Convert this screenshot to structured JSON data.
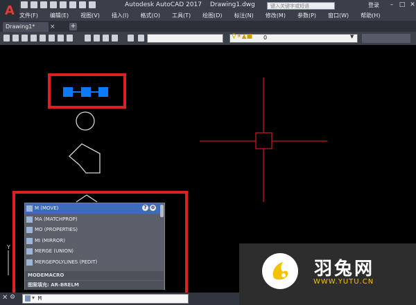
{
  "window": {
    "app_logo": "A",
    "title_app": "Autodesk AutoCAD 2017",
    "title_file": "Drawing1.dwg",
    "search_placeholder": "键入关键字或短语",
    "login_label": "登录",
    "controls": [
      "–",
      "□",
      "✕"
    ]
  },
  "menu": {
    "items": [
      "文件(F)",
      "编辑(E)",
      "视图(V)",
      "插入(I)",
      "格式(O)",
      "工具(T)",
      "绘图(D)",
      "标注(N)",
      "修改(M)",
      "参数(P)",
      "窗口(W)",
      "帮助(H)"
    ]
  },
  "tabs": {
    "drawing": "Drawing1*",
    "close": "×",
    "add": "+"
  },
  "toolbar": {
    "layer_value": "0",
    "layer_icons": "♀☀▲■"
  },
  "autocomplete": {
    "items": [
      {
        "label": "M (MOVE)"
      },
      {
        "label": "MA (MATCHPROP)"
      },
      {
        "label": "MO (PROPERTIES)"
      },
      {
        "label": "MI (MIRROR)"
      },
      {
        "label": "MERGE (UNION)"
      },
      {
        "label": "MERGEPOLYLINES (PEDIT)"
      }
    ],
    "sections": [
      "MODEMACRO",
      "图案填充: AR-BRELM"
    ],
    "help_label": "?",
    "internet_label": "⊕"
  },
  "command_line": {
    "input_value": "M",
    "close_glyph": "✕",
    "wrench_glyph": "⚙",
    "prompt_arrow": "▾"
  },
  "axis": {
    "y_label": "Y"
  },
  "watermark": {
    "cn": "羽兔网",
    "url": "WWW.YUTU.CN"
  },
  "colors": {
    "highlight": "#e01f1f",
    "grip": "#0a7bff",
    "crosshair": "#c8161d",
    "watermark_accent": "#f3c300"
  }
}
